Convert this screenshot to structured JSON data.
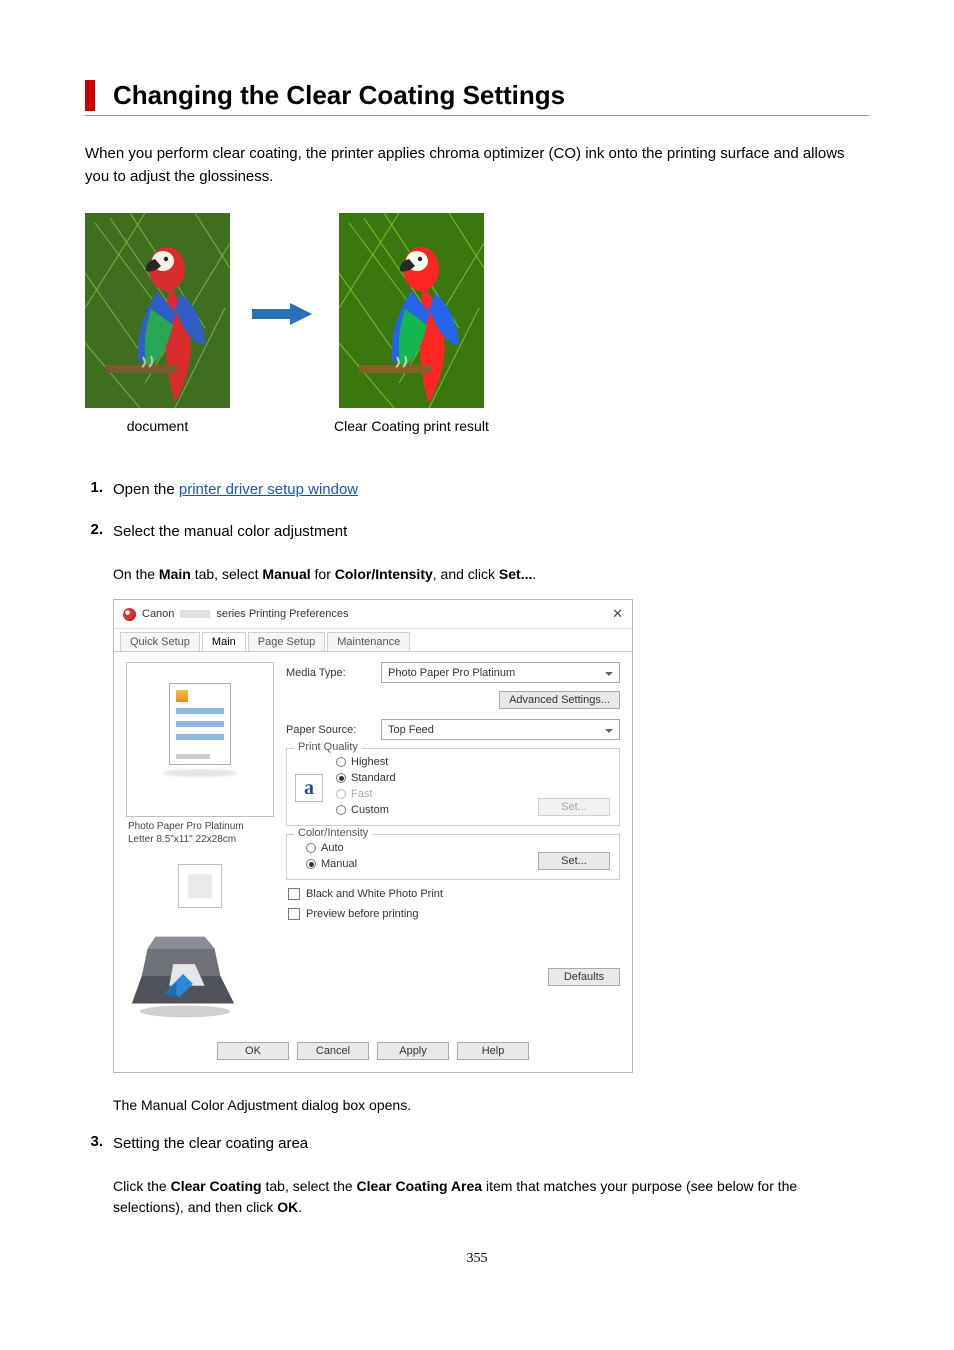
{
  "page_title": "Changing the Clear Coating Settings",
  "intro": "When you perform clear coating, the printer applies chroma optimizer (CO) ink onto the printing surface and allows you to adjust the glossiness.",
  "figure": {
    "left_label": "document",
    "right_label": "Clear Coating print result"
  },
  "steps": [
    {
      "num": "1.",
      "lead": "Open the ",
      "link": "printer driver setup window"
    },
    {
      "num": "2.",
      "head": "Select the manual color adjustment",
      "desc_pre": "On the ",
      "desc_b1": "Main",
      "desc_mid1": " tab, select ",
      "desc_b2": "Manual",
      "desc_mid2": " for ",
      "desc_b3": "Color/Intensity",
      "desc_mid3": ", and click ",
      "desc_b4": "Set...",
      "desc_end": ".",
      "dialog_after_pre": "The ",
      "dialog_after_b": "Manual Color Adjustment",
      "dialog_after_end": " dialog box opens."
    },
    {
      "num": "3.",
      "head": "Setting the clear coating area",
      "desc_pre": "Click the ",
      "desc_b1": "Clear Coating",
      "desc_mid1": " tab, select the ",
      "desc_b2": "Clear Coating Area",
      "desc_mid2": " item that matches your purpose (see below for the selections), and then click ",
      "desc_b3": "OK",
      "desc_end": "."
    }
  ],
  "dialog": {
    "title_prefix": "Canon",
    "title_suffix": "series Printing Preferences",
    "tabs": [
      "Quick Setup",
      "Main",
      "Page Setup",
      "Maintenance"
    ],
    "media_type_label": "Media Type:",
    "media_type_value": "Photo Paper Pro Platinum",
    "advanced_settings": "Advanced Settings...",
    "paper_source_label": "Paper Source:",
    "paper_source_value": "Top Feed",
    "print_quality_label": "Print Quality",
    "pq_options": [
      "Highest",
      "Standard",
      "Fast",
      "Custom"
    ],
    "pq_set": "Set...",
    "color_intensity_label": "Color/Intensity",
    "ci_options": [
      "Auto",
      "Manual"
    ],
    "ci_set": "Set...",
    "bw_label": "Black and White Photo Print",
    "preview_label": "Preview before printing",
    "defaults": "Defaults",
    "preview_caption_line1": "Photo Paper Pro Platinum",
    "preview_caption_line2": "Letter 8.5\"x11\" 22x28cm",
    "a_icon": "a",
    "buttons": [
      "OK",
      "Cancel",
      "Apply",
      "Help"
    ]
  },
  "page_number": "355"
}
